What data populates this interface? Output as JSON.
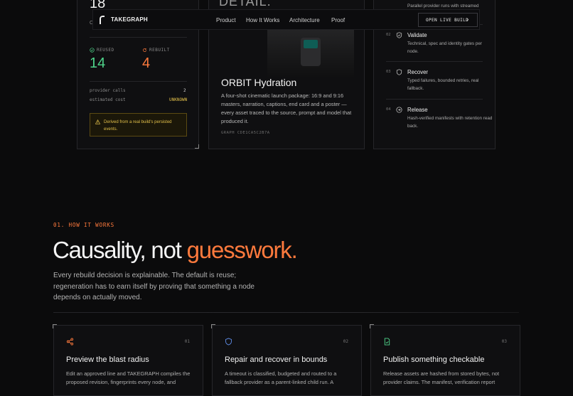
{
  "nav": {
    "brand": "TAKEGRAPH",
    "links": [
      "Product",
      "How It Works",
      "Architecture",
      "Proof"
    ],
    "cta": "OPEN LIVE BUILD",
    "cta_arrow": "›"
  },
  "stats_panel": {
    "top_value": "18",
    "top_sub": "C",
    "reused_label": "REUSED",
    "reused_value": "14",
    "rebuilt_label": "REBUILT",
    "rebuilt_value": "4",
    "rows": [
      {
        "label": "provider calls",
        "value": "2"
      },
      {
        "label": "estimated cost",
        "value": "UNKNOWN"
      }
    ],
    "note": "Derived from a real build's persisted events.",
    "colors": {
      "reused": "#4fd38a",
      "rebuilt": "#ff7a3d",
      "warning": "#e3c04a"
    }
  },
  "preview_panel": {
    "heading": "DETAIL.",
    "title": "ORBIT Hydration",
    "description": "A four-shot cinematic launch package: 16:9 and 9:16 masters, narration, captions, end card and a poster — every asset traced to the source, prompt and model that produced it.",
    "graph_id": "GRAPH CDE1CA5C2B7A"
  },
  "steps_panel": {
    "top_desc": "Parallel provider runs with streamed",
    "steps": [
      {
        "num": "02",
        "title": "Validate",
        "desc": "Technical, spec and identity gates per node.",
        "icon": "shield-check-icon"
      },
      {
        "num": "03",
        "title": "Recover",
        "desc": "Typed failures, bounded retries, real fallback.",
        "icon": "shield-icon"
      },
      {
        "num": "04",
        "title": "Release",
        "desc": "Hash-verified manifests with retention read back.",
        "icon": "arrow-circle-icon"
      }
    ]
  },
  "section": {
    "label": "01. HOW IT WORKS",
    "headline_main": "Causality, not ",
    "headline_accent": "guesswork.",
    "lead": "Every rebuild decision is explainable. The default is reuse; regeneration has to earn itself by proving that something a node depends on actually moved.",
    "accent_color": "#ff7a3d"
  },
  "features": [
    {
      "num": "01",
      "title": "Preview the blast radius",
      "desc": "Edit an approved line and TAKEGRAPH compiles the proposed revision, fingerprints every node, and",
      "icon": "share-nodes-icon"
    },
    {
      "num": "02",
      "title": "Repair and recover in bounds",
      "desc": "A timeout is classified, budgeted and routed to a fallback provider as a parent-linked child run. A",
      "icon": "shield-icon"
    },
    {
      "num": "03",
      "title": "Publish something checkable",
      "desc": "Release assets are hashed from stored bytes, not provider claims. The manifest, verification report",
      "icon": "document-check-icon"
    }
  ]
}
